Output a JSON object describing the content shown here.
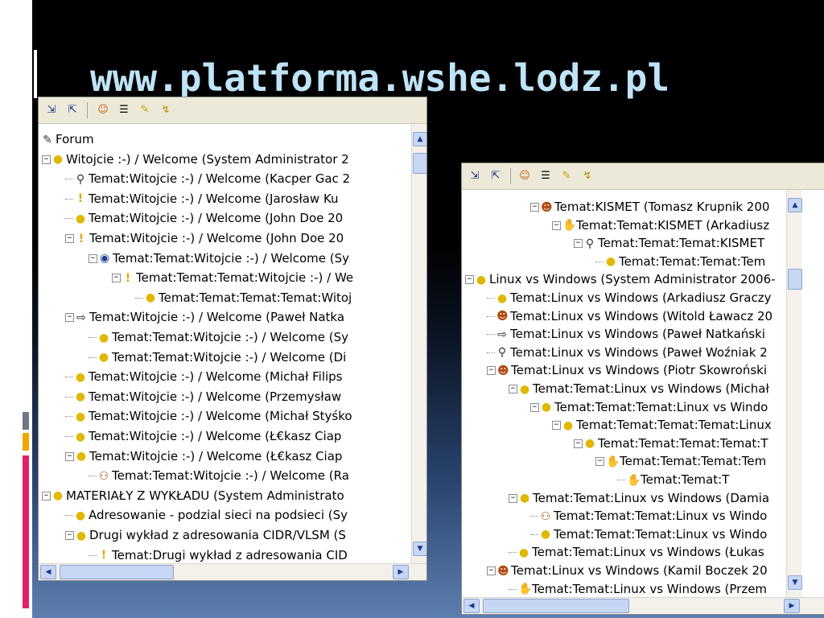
{
  "slide": {
    "title": "www.platforma.wshe.lodz.pl"
  },
  "colors": {
    "title": "#bfe3f7",
    "deco_gray": "#a0a0a0",
    "deco_orange": "#f0a800",
    "deco_pink": "#e0206a"
  },
  "left_window": {
    "toolbar": [
      "tree-expand-icon",
      "tree-collapse-icon",
      "user-icon",
      "list-icon",
      "edit-icon",
      "chart-icon"
    ],
    "rows": [
      {
        "icon": "forum",
        "text": "Forum"
      },
      {
        "icon": "bulb",
        "text": "Witojcie :-) /  Welcome (System Administrator 2"
      },
      {
        "icon": "mag",
        "text": "Temat:Witojcie :-) /  Welcome (Kacper Gac 2"
      },
      {
        "icon": "excl",
        "text": "Temat:Witojcie :-) /  Welcome (Jarosław Ku"
      },
      {
        "icon": "bulb",
        "text": "Temat:Witojcie :-) /  Welcome (John Doe 20"
      },
      {
        "icon": "excl",
        "text": "Temat:Witojcie :-) /  Welcome (John Doe 20"
      },
      {
        "icon": "eye",
        "text": "Temat:Temat:Witojcie :-) /  Welcome (Sy"
      },
      {
        "icon": "excl",
        "text": "Temat:Temat:Temat:Witojcie :-) /  We"
      },
      {
        "icon": "bulb",
        "text": "Temat:Temat:Temat:Temat:Witoj"
      },
      {
        "icon": "arrow",
        "text": "Temat:Witojcie :-) /  Welcome (Paweł Natka"
      },
      {
        "icon": "bulb",
        "text": "Temat:Temat:Witojcie :-) /  Welcome (Sy"
      },
      {
        "icon": "bulb",
        "text": "Temat:Temat:Witojcie :-) /  Welcome (Di"
      },
      {
        "icon": "bulb",
        "text": "Temat:Witojcie :-) /  Welcome (Michał Filips"
      },
      {
        "icon": "bulb",
        "text": "Temat:Witojcie :-) /  Welcome (Przemysław"
      },
      {
        "icon": "bulb",
        "text": "Temat:Witojcie :-) /  Welcome (Michał Styśko"
      },
      {
        "icon": "bulb",
        "text": "Temat:Witojcie :-) /  Welcome (Ł€kasz Ciap"
      },
      {
        "icon": "bulb",
        "text": "Temat:Witojcie :-) /  Welcome (Ł€kasz Ciap"
      },
      {
        "icon": "people",
        "text": "Temat:Temat:Witojcie :-) /  Welcome (Ra"
      },
      {
        "icon": "bulb",
        "text": "MATERIAŁY Z WYKŁADU (System Administrato"
      },
      {
        "icon": "bulb",
        "text": "Adresowanie - podzial sieci na podsieci (Sy"
      },
      {
        "icon": "bulb",
        "text": "Drugi wykład z adresowania CIDR/VLSM (S"
      },
      {
        "icon": "excl",
        "text": "Temat:Drugi wykład z adresowania CID"
      }
    ]
  },
  "right_window": {
    "toolbar": [
      "tree-expand-icon",
      "tree-collapse-icon",
      "user-icon",
      "list-icon",
      "edit-icon",
      "chart-icon"
    ],
    "rows": [
      {
        "icon": "person",
        "text": "Temat:KISMET (Tomasz Krupnik 200"
      },
      {
        "icon": "hand",
        "text": "Temat:Temat:KISMET (Arkadiusz"
      },
      {
        "icon": "mag",
        "text": "Temat:Temat:Temat:KISMET"
      },
      {
        "icon": "bulb",
        "text": "Temat:Temat:Temat:Tem"
      },
      {
        "icon": "bulb",
        "text": "Linux vs Windows (System Administrator 2006-"
      },
      {
        "icon": "bulb",
        "text": "Temat:Linux vs Windows (Arkadiusz Graczy"
      },
      {
        "icon": "person",
        "text": "Temat:Linux vs Windows (Witold Ławacz 20"
      },
      {
        "icon": "arrow",
        "text": "Temat:Linux vs Windows (Paweł Natkański"
      },
      {
        "icon": "mag",
        "text": "Temat:Linux vs Windows (Paweł Woźniak 2"
      },
      {
        "icon": "person",
        "text": "Temat:Linux vs Windows (Piotr Skowroński"
      },
      {
        "icon": "bulb",
        "text": "Temat:Temat:Linux vs Windows (Michał"
      },
      {
        "icon": "bulb",
        "text": "Temat:Temat:Temat:Linux vs Windo"
      },
      {
        "icon": "bulb",
        "text": "Temat:Temat:Temat:Temat:Linux"
      },
      {
        "icon": "bulb",
        "text": "Temat:Temat:Temat:Temat:T"
      },
      {
        "icon": "hand",
        "text": "Temat:Temat:Temat:Tem"
      },
      {
        "icon": "hand",
        "text": "Temat:Temat:T"
      },
      {
        "icon": "bulb",
        "text": "Temat:Temat:Linux vs Windows (Damia"
      },
      {
        "icon": "people",
        "text": "Temat:Temat:Temat:Linux vs Windo"
      },
      {
        "icon": "bulb",
        "text": "Temat:Temat:Temat:Linux vs Windo"
      },
      {
        "icon": "bulb",
        "text": "Temat:Temat:Linux vs Windows (Łukas"
      },
      {
        "icon": "person",
        "text": "Temat:Linux vs Windows (Kamil Boczek 20"
      },
      {
        "icon": "hand",
        "text": "Temat:Temat:Linux vs Windows (Przem"
      }
    ]
  }
}
